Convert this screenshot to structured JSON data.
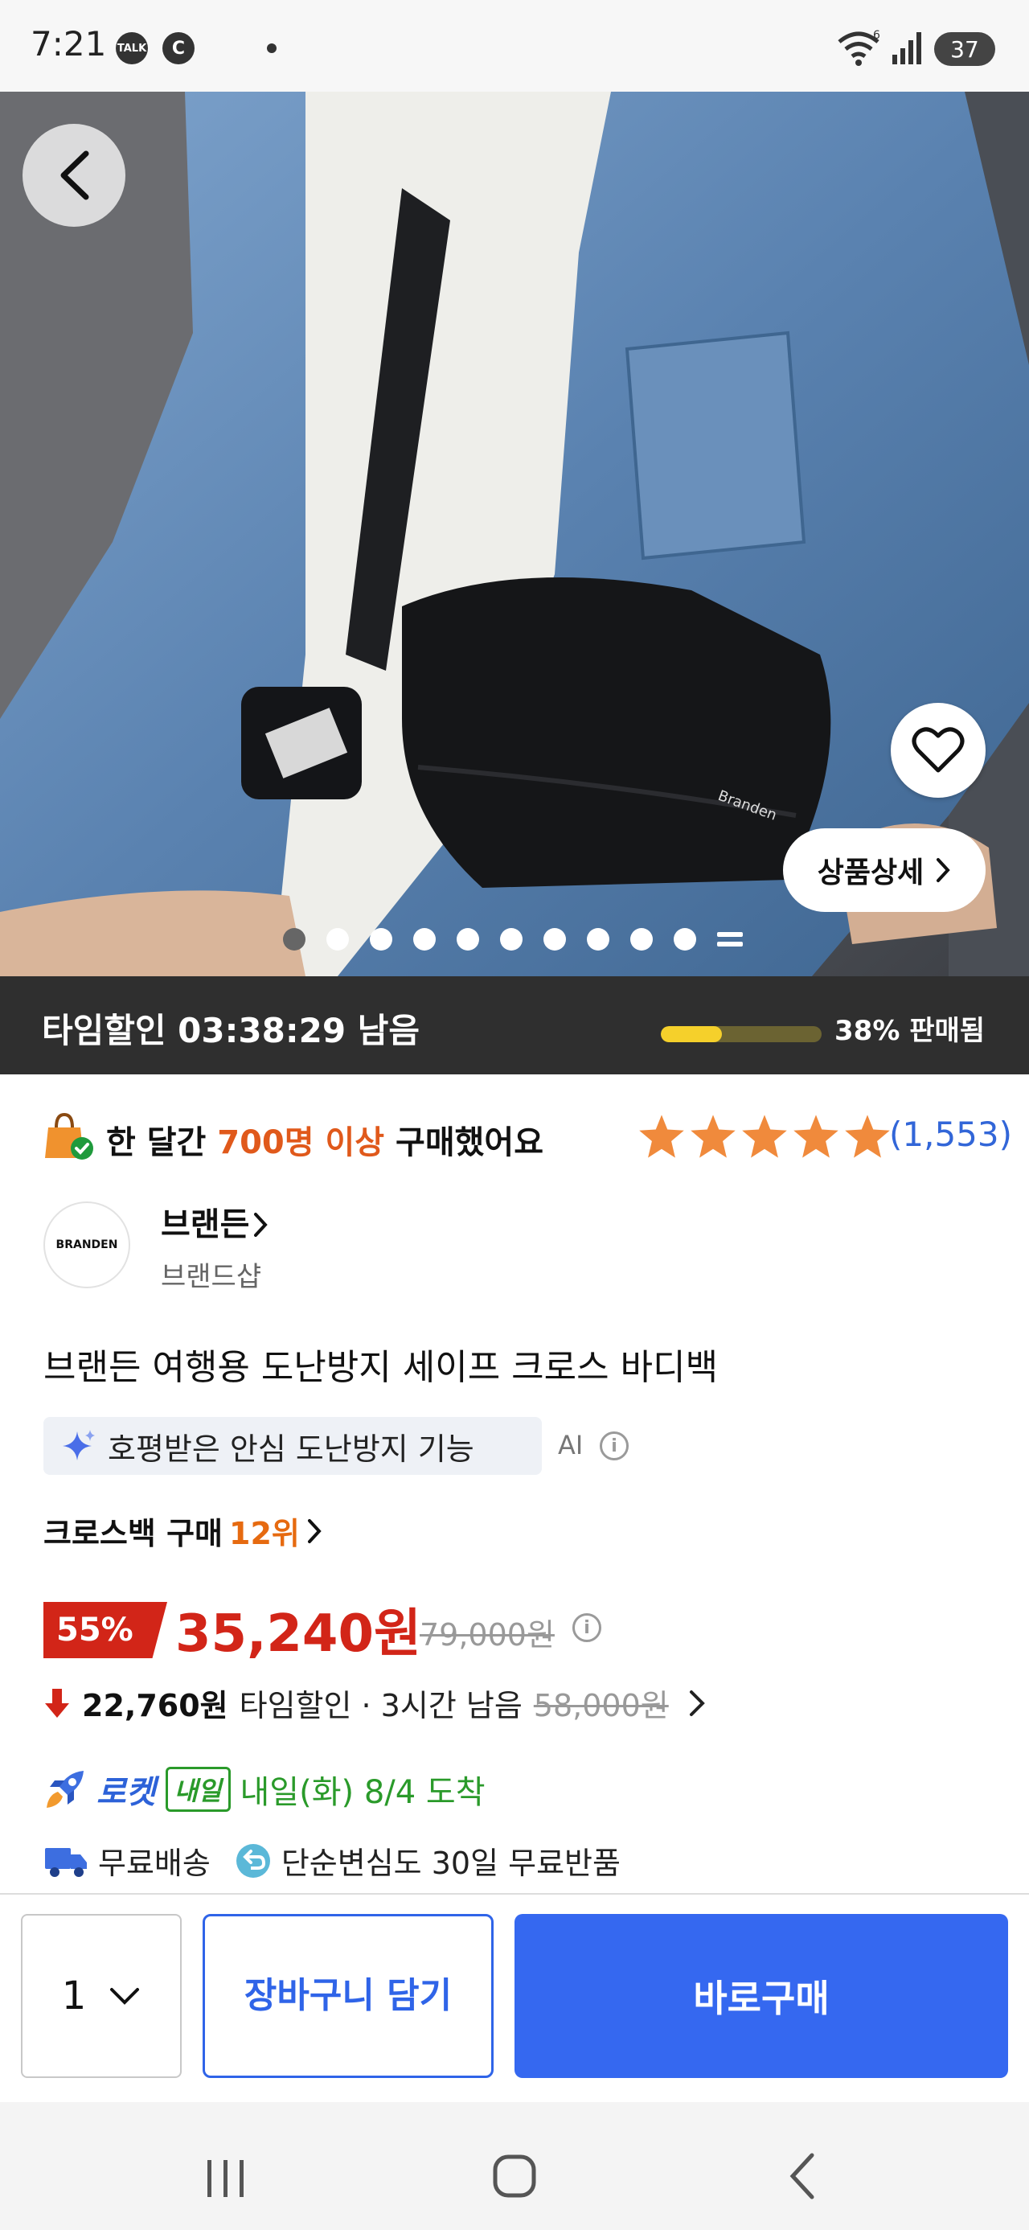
{
  "status_bar": {
    "time": "7:21",
    "kakao_label": "TALK",
    "c_label": "C",
    "battery": "37"
  },
  "hero": {
    "detail_button": "상품상세",
    "image_count": 11,
    "active_index": 0
  },
  "time_sale": {
    "text": "타임할인 03:38:29 남음",
    "sold_progress": 0.38,
    "sold_text": "38% 판매됨"
  },
  "social_proof": {
    "prefix": "한 달간 ",
    "highlight": "700명 이상",
    "suffix": " 구매했어요",
    "rating": 5,
    "reviews": "(1,553)"
  },
  "seller": {
    "logo_text": "BRANDEN",
    "name": "브랜든",
    "shop": "브랜드샵"
  },
  "product": {
    "title": "브랜든 여행용 도난방지 세이프 크로스 바디백",
    "ai_chip": "호평받은 안심 도난방지 기능",
    "ai_label": "AI",
    "rank_prefix": "크로스백 구매 ",
    "rank_value": "12위"
  },
  "price": {
    "discount": "55%",
    "sale_price": "35,240원",
    "original_price": "79,000원",
    "time_price": "22,760원",
    "time_label": "타임할인 · 3시간 남음",
    "time_original": "58,000원"
  },
  "delivery": {
    "rocket": "로켓",
    "tomorrow": "내일",
    "arrival": "내일(화) 8/4 도착",
    "free_shipping": "무료배송",
    "return_policy": "단순변심도 30일 무료반품"
  },
  "bottom_bar": {
    "quantity": "1",
    "cart_button": "장바구니 담기",
    "buy_button": "바로구매"
  },
  "colors": {
    "accent_blue": "#3568f0",
    "sale_red": "#d22518",
    "highlight_orange": "#e0591b",
    "star_orange": "#f08a3c",
    "rocket_green": "#2a9a2a"
  }
}
